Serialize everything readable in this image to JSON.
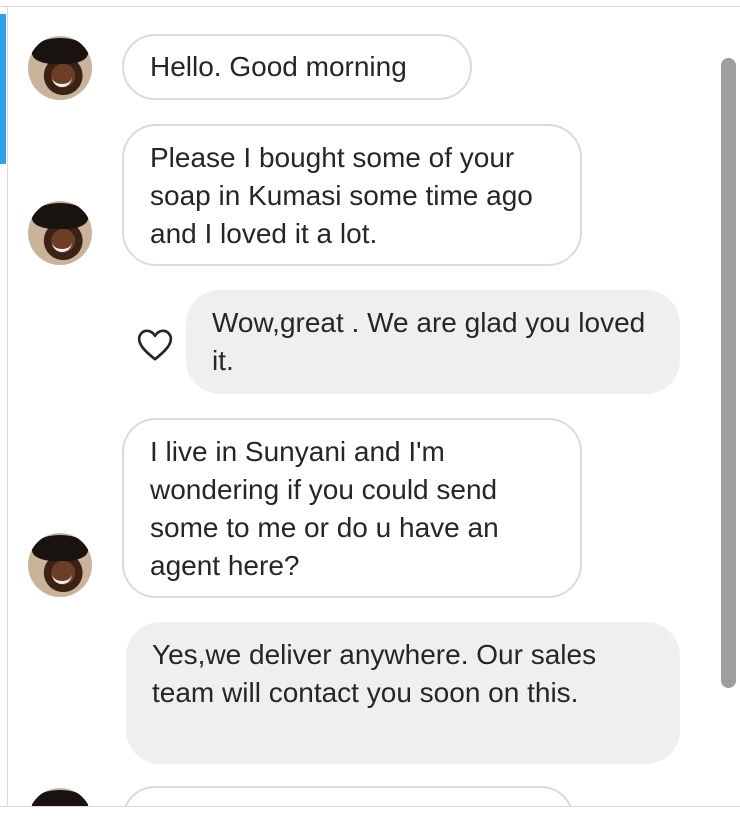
{
  "thread": {
    "messages": [
      {
        "direction": "incoming",
        "text": "Hello. Good morning",
        "avatar": "contact-avatar"
      },
      {
        "direction": "incoming",
        "text": "Please I bought some of your soap in Kumasi some time ago and I loved it a lot.",
        "avatar": "contact-avatar"
      },
      {
        "direction": "outgoing",
        "text": "Wow,great . We are glad you loved it.",
        "icon": "heart-outline-icon"
      },
      {
        "direction": "incoming",
        "text": "I live in Sunyani and I'm wondering if you could send some to me or do u have an agent here?",
        "avatar": "contact-avatar"
      },
      {
        "direction": "outgoing",
        "text": "Yes,we deliver anywhere. Our sales team will contact you soon on this."
      }
    ]
  },
  "colors": {
    "active_indicator": "#2ea2e8",
    "incoming_bubble_border": "#dbdbdb",
    "outgoing_bubble_bg": "#efefef",
    "scrollbar": "#9e9e9e",
    "text": "#262626"
  }
}
